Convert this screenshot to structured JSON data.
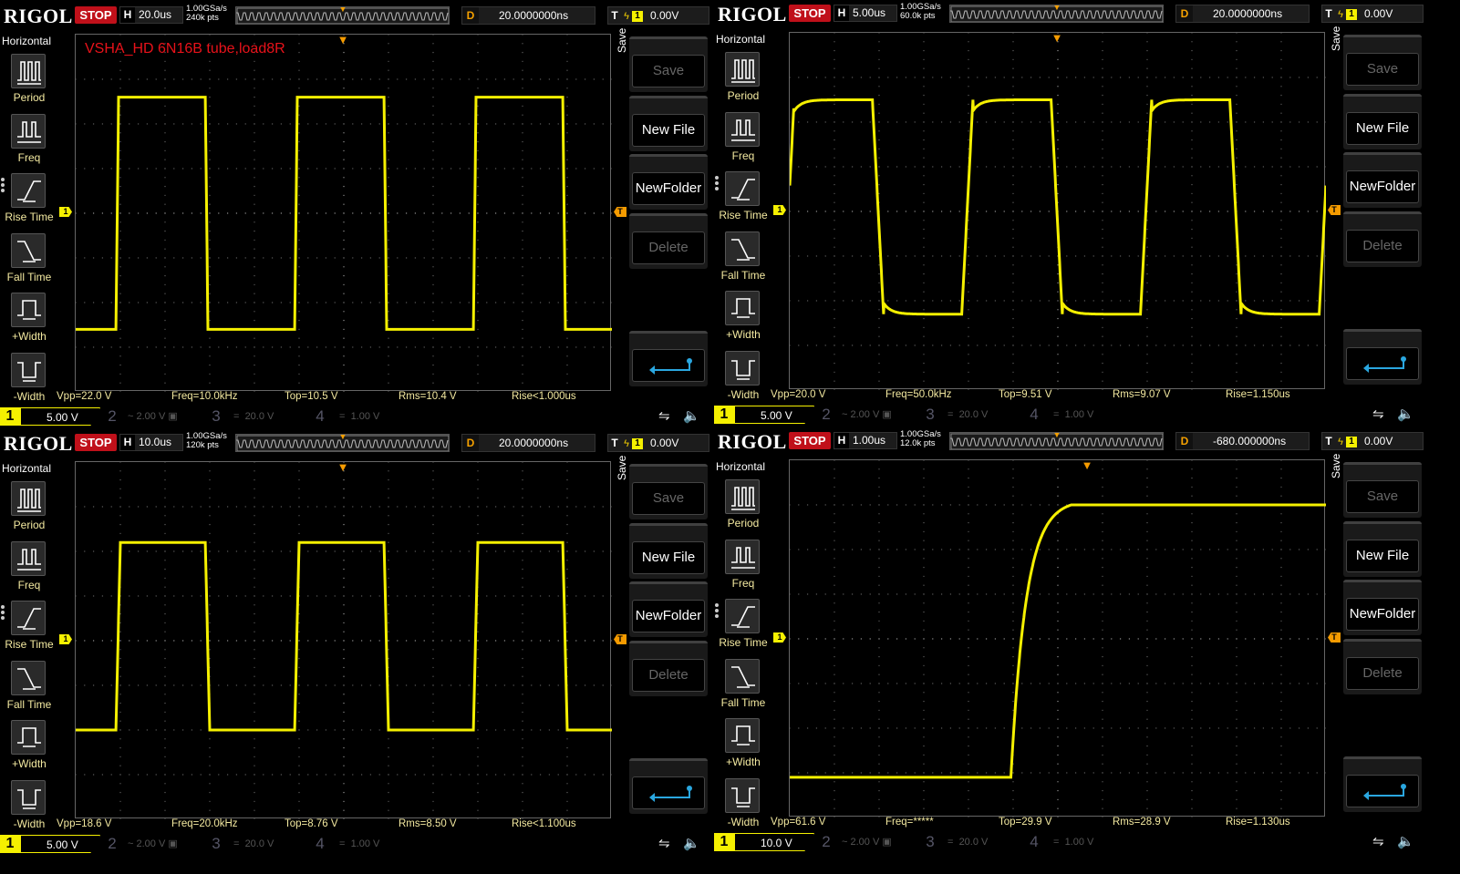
{
  "scopes": [
    {
      "logo": "RIGOL",
      "status": "STOP",
      "h_label": "H",
      "timebase": "20.0us",
      "sample_rate": "1.00GSa/s",
      "mem_depth": "240k pts",
      "d_label": "D",
      "delay": "20.0000000ns",
      "t_label": "T",
      "trig_source": "1",
      "trig_level": "0.00V",
      "annotation": "VSHA_HD 6N16B tube,load8R",
      "horizontal_title": "Horizontal",
      "tools": [
        "Period",
        "Freq",
        "Rise Time",
        "Fall Time",
        "+Width",
        "-Width"
      ],
      "menu": {
        "title": "Save",
        "save": "Save",
        "new_file": "New File",
        "new_folder": "NewFolder",
        "delete": "Delete"
      },
      "measurements": {
        "vpp": "Vpp=22.0 V",
        "freq": "Freq=10.0kHz",
        "top": "Top=10.5 V",
        "rms": "Rms=10.4 V",
        "rise": "Rise<1.000us"
      },
      "channels": {
        "ch1": "1",
        "ch1_scale": "5.00 V",
        "ch2": "2",
        "ch2_scale": "2.00 V",
        "ch3": "3",
        "ch3_scale": "20.0 V",
        "ch4": "4",
        "ch4_scale": "1.00 V"
      },
      "waveform": {
        "shape": "square",
        "period_div": 4.0,
        "phase_div": 0.9,
        "high_div": 2.6,
        "low_div": -2.6,
        "edge_div": 0.06,
        "ringing": false
      },
      "level_marker_div": 0
    },
    {
      "logo": "RIGOL",
      "status": "STOP",
      "h_label": "H",
      "timebase": "5.00us",
      "sample_rate": "1.00GSa/s",
      "mem_depth": "60.0k pts",
      "d_label": "D",
      "delay": "20.0000000ns",
      "t_label": "T",
      "trig_source": "1",
      "trig_level": "0.00V",
      "annotation": "",
      "horizontal_title": "Horizontal",
      "tools": [
        "Period",
        "Freq",
        "Rise Time",
        "Fall Time",
        "+Width",
        "-Width"
      ],
      "menu": {
        "title": "Save",
        "save": "Save",
        "new_file": "New File",
        "new_folder": "NewFolder",
        "delete": "Delete"
      },
      "measurements": {
        "vpp": "Vpp=20.0 V",
        "freq": "Freq=50.0kHz",
        "top": "Top=9.51 V",
        "rms": "Rms=9.07 V",
        "rise": "Rise=1.150us"
      },
      "channels": {
        "ch1": "1",
        "ch1_scale": "5.00 V",
        "ch2": "2",
        "ch2_scale": "2.00 V",
        "ch3": "3",
        "ch3_scale": "20.0 V",
        "ch4": "4",
        "ch4_scale": "1.00 V"
      },
      "waveform": {
        "shape": "square",
        "period_div": 4.0,
        "phase_div": -0.15,
        "high_div": 2.5,
        "low_div": -2.3,
        "edge_div": 0.25,
        "ringing": true
      },
      "level_marker_div": 0
    },
    {
      "logo": "RIGOL",
      "status": "STOP",
      "h_label": "H",
      "timebase": "10.0us",
      "sample_rate": "1.00GSa/s",
      "mem_depth": "120k pts",
      "d_label": "D",
      "delay": "20.0000000ns",
      "t_label": "T",
      "trig_source": "1",
      "trig_level": "0.00V",
      "annotation": "",
      "horizontal_title": "Horizontal",
      "tools": [
        "Period",
        "Freq",
        "Rise Time",
        "Fall Time",
        "+Width",
        "-Width"
      ],
      "menu": {
        "title": "Save",
        "save": "Save",
        "new_file": "New File",
        "new_folder": "NewFolder",
        "delete": "Delete"
      },
      "measurements": {
        "vpp": "Vpp=18.6 V",
        "freq": "Freq=20.0kHz",
        "top": "Top=8.76 V",
        "rms": "Rms=8.50 V",
        "rise": "Rise<1.100us"
      },
      "channels": {
        "ch1": "1",
        "ch1_scale": "5.00 V",
        "ch2": "2",
        "ch2_scale": "2.00 V",
        "ch3": "3",
        "ch3_scale": "20.0 V",
        "ch4": "4",
        "ch4_scale": "1.00 V"
      },
      "waveform": {
        "shape": "square",
        "period_div": 4.0,
        "phase_div": 0.9,
        "high_div": 2.2,
        "low_div": -2.0,
        "edge_div": 0.1,
        "ringing": false
      },
      "level_marker_div": 0
    },
    {
      "logo": "RIGOL",
      "status": "STOP",
      "h_label": "H",
      "timebase": "1.00us",
      "sample_rate": "1.00GSa/s",
      "mem_depth": "12.0k pts",
      "d_label": "D",
      "delay": "-680.000000ns",
      "t_label": "T",
      "trig_source": "1",
      "trig_level": "0.00V",
      "annotation": "",
      "horizontal_title": "Horizontal",
      "tools": [
        "Period",
        "Freq",
        "Rise Time",
        "Fall Time",
        "+Width",
        "-Width"
      ],
      "menu": {
        "title": "Save",
        "save": "Save",
        "new_file": "New File",
        "new_folder": "NewFolder",
        "delete": "Delete"
      },
      "measurements": {
        "vpp": "Vpp=61.6 V",
        "freq": "Freq=*****",
        "top": "Top=29.9 V",
        "rms": "Rms=28.9 V",
        "rise": "Rise=1.130us"
      },
      "channels": {
        "ch1": "1",
        "ch1_scale": "10.0 V",
        "ch2": "2",
        "ch2_scale": "2.00 V",
        "ch3": "3",
        "ch3_scale": "20.0 V",
        "ch4": "4",
        "ch4_scale": "1.00 V"
      },
      "waveform": {
        "shape": "step",
        "step_start_div": 4.95,
        "step_end_div": 6.3,
        "high_div": 3.0,
        "low_div": -3.1
      },
      "level_marker_div": 0
    }
  ],
  "colors": {
    "trace": "#f5f000",
    "stop": "#c0101a",
    "trigger": "#f59b00",
    "annotation": "#e8121a",
    "meas_text": "#f3e9a0"
  }
}
